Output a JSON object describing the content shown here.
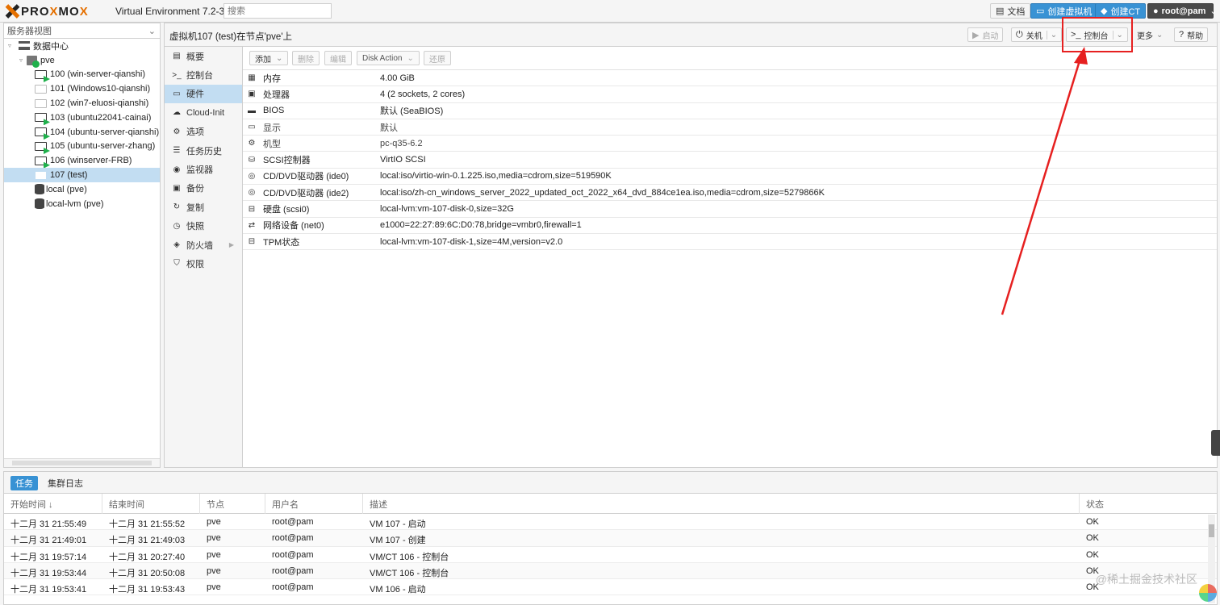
{
  "app": {
    "logo_a": "PRO",
    "logo_x": "X",
    "logo_b": "MO",
    "logo_c": "X",
    "version": "Virtual Environment 7.2-3",
    "search_placeholder": "搜索",
    "docs": "文档",
    "create_vm": "创建虚拟机",
    "create_ct": "创建CT",
    "user": "root@pam"
  },
  "tree": {
    "view": "服务器视图",
    "datacenter": "数据中心",
    "node": "pve",
    "vms": [
      {
        "label": "100 (win-server-qianshi)",
        "state": "running"
      },
      {
        "label": "101 (Windows10-qianshi)",
        "state": "stopped"
      },
      {
        "label": "102 (win7-eluosi-qianshi)",
        "state": "stopped"
      },
      {
        "label": "103 (ubuntu22041-cainai)",
        "state": "running"
      },
      {
        "label": "104 (ubuntu-server-qianshi)",
        "state": "running"
      },
      {
        "label": "105 (ubuntu-server-zhang)",
        "state": "running"
      },
      {
        "label": "106 (winserver-FRB)",
        "state": "running"
      },
      {
        "label": "107 (test)",
        "state": "selected"
      }
    ],
    "storages": [
      "local (pve)",
      "local-lvm (pve)"
    ]
  },
  "main": {
    "title": "虚拟机107 (test)在节点'pve'上",
    "start": "启动",
    "shutdown": "关机",
    "console": "控制台",
    "more": "更多",
    "help": "帮助"
  },
  "nav": [
    {
      "icon": "▤",
      "label": "概要"
    },
    {
      "icon": ">_",
      "label": "控制台"
    },
    {
      "icon": "▭",
      "label": "硬件"
    },
    {
      "icon": "☁",
      "label": "Cloud-Init"
    },
    {
      "icon": "⚙",
      "label": "选项"
    },
    {
      "icon": "☰",
      "label": "任务历史"
    },
    {
      "icon": "◉",
      "label": "监视器"
    },
    {
      "icon": "▣",
      "label": "备份"
    },
    {
      "icon": "↻",
      "label": "复制"
    },
    {
      "icon": "◷",
      "label": "快照"
    },
    {
      "icon": "◈",
      "label": "防火墙"
    },
    {
      "icon": "⛉",
      "label": "权限"
    }
  ],
  "toolbar": {
    "add": "添加",
    "remove": "删除",
    "edit": "编辑",
    "disk_action": "Disk Action",
    "revert": "还原"
  },
  "hardware": [
    {
      "icon": "▦",
      "name": "内存",
      "value": "4.00 GiB"
    },
    {
      "icon": "▣",
      "name": "处理器",
      "value": "4 (2 sockets, 2 cores)"
    },
    {
      "icon": "▬",
      "name": "BIOS",
      "value": "默认 (SeaBIOS)"
    },
    {
      "icon": "▭",
      "name": "显示",
      "value": "默认"
    },
    {
      "icon": "⚙",
      "name": "机型",
      "value": "pc-q35-6.2"
    },
    {
      "icon": "⛁",
      "name": "SCSI控制器",
      "value": "VirtIO SCSI"
    },
    {
      "icon": "◎",
      "name": "CD/DVD驱动器 (ide0)",
      "value": "local:iso/virtio-win-0.1.225.iso,media=cdrom,size=519590K"
    },
    {
      "icon": "◎",
      "name": "CD/DVD驱动器 (ide2)",
      "value": "local:iso/zh-cn_windows_server_2022_updated_oct_2022_x64_dvd_884ce1ea.iso,media=cdrom,size=5279866K"
    },
    {
      "icon": "⊟",
      "name": "硬盘 (scsi0)",
      "value": "local-lvm:vm-107-disk-0,size=32G"
    },
    {
      "icon": "⇄",
      "name": "网络设备 (net0)",
      "value": "e1000=22:27:89:6C:D0:78,bridge=vmbr0,firewall=1"
    },
    {
      "icon": "⊟",
      "name": "TPM状态",
      "value": "local-lvm:vm-107-disk-1,size=4M,version=v2.0"
    }
  ],
  "tasks": {
    "tab_tasks": "任务",
    "tab_cluster_log": "集群日志",
    "columns": [
      "开始时间 ↓",
      "结束时间",
      "节点",
      "用户名",
      "描述",
      "状态"
    ],
    "rows": [
      [
        "十二月 31 21:55:49",
        "十二月 31 21:55:52",
        "pve",
        "root@pam",
        "VM 107 - 启动",
        "OK"
      ],
      [
        "十二月 31 21:49:01",
        "十二月 31 21:49:03",
        "pve",
        "root@pam",
        "VM 107 - 创建",
        "OK"
      ],
      [
        "十二月 31 19:57:14",
        "十二月 31 20:27:40",
        "pve",
        "root@pam",
        "VM/CT 106 - 控制台",
        "OK"
      ],
      [
        "十二月 31 19:53:44",
        "十二月 31 20:50:08",
        "pve",
        "root@pam",
        "VM/CT 106 - 控制台",
        "OK"
      ],
      [
        "十二月 31 19:53:41",
        "十二月 31 19:53:43",
        "pve",
        "root@pam",
        "VM 106 - 启动",
        "OK"
      ]
    ]
  },
  "watermark": "@稀土掘金技术社区",
  "colors": {
    "accent": "#3892d4",
    "selected": "#c2ddf2",
    "annotation": "#e62020",
    "logo_orange": "#e57000"
  }
}
